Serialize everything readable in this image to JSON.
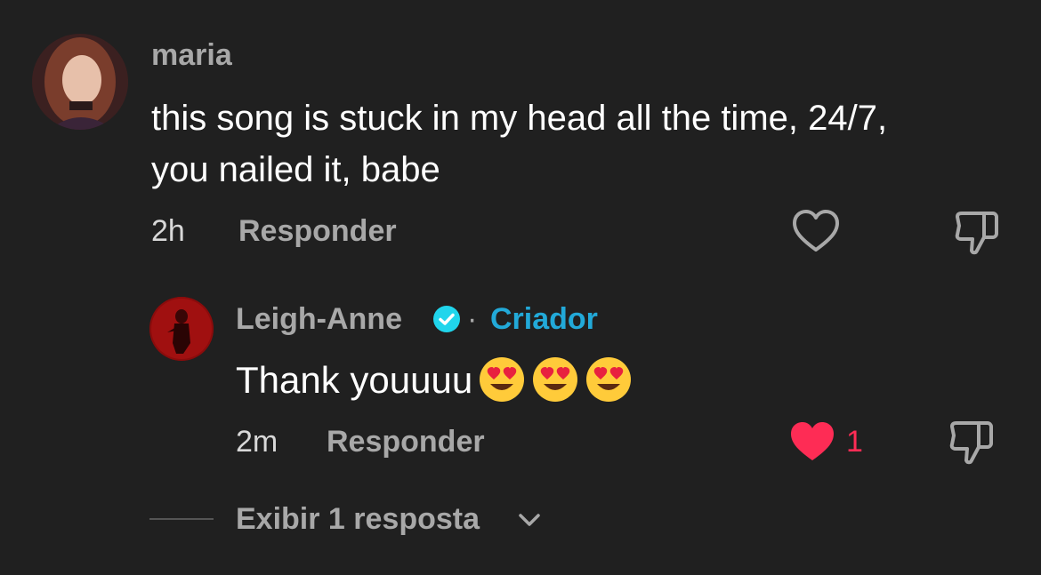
{
  "comment": {
    "username": "maria",
    "text": "this song is stuck in my head all the time, 24/7, you nailed it, babe",
    "time": "2h",
    "reply_label": "Responder",
    "icons": {
      "avatar": "user-avatar",
      "like": "heart-outline-icon",
      "dislike": "thumbs-down-outline-icon"
    }
  },
  "reply": {
    "username": "Leigh-Anne",
    "separator": "·",
    "creator_label": "Criador",
    "text": "Thank youuuu",
    "emojis": [
      "heart-eyes-emoji",
      "heart-eyes-emoji",
      "heart-eyes-emoji"
    ],
    "time": "2m",
    "reply_label": "Responder",
    "like_count": "1",
    "icons": {
      "avatar": "creator-avatar",
      "verified": "verified-check-icon",
      "like": "heart-filled-icon",
      "dislike": "thumbs-down-outline-icon"
    }
  },
  "view_replies": {
    "label": "Exibir 1 resposta",
    "icon": "chevron-down-icon"
  },
  "colors": {
    "background": "#202020",
    "secondary_text": "#a8a8a8",
    "creator_blue": "#22a9d8",
    "like_red": "#fe2c55"
  }
}
